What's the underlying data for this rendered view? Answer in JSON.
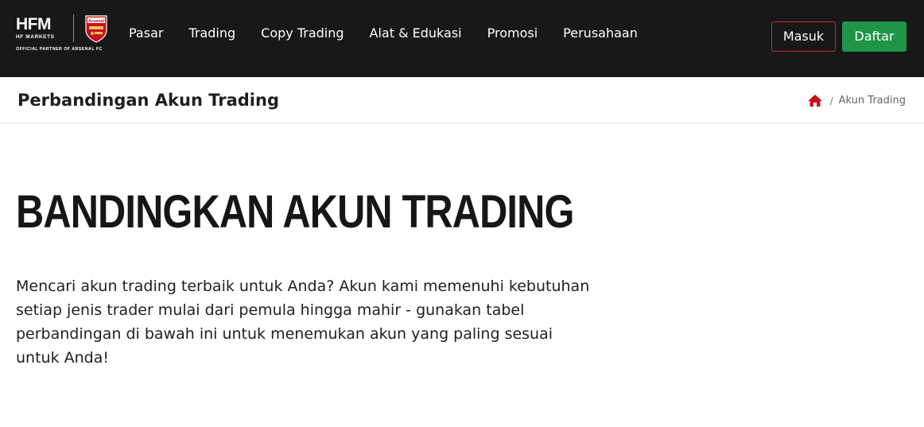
{
  "brand": {
    "logo_text": "HFM",
    "logo_subtext": "HF MARKETS",
    "partner_text": "OFFICIAL PARTNER OF ARSENAL FC",
    "crest_text": "Arsenal"
  },
  "nav": {
    "items": [
      "Pasar",
      "Trading",
      "Copy Trading",
      "Alat & Edukasi",
      "Promosi",
      "Perusahaan"
    ]
  },
  "auth": {
    "login_label": "Masuk",
    "register_label": "Daftar"
  },
  "page_header": {
    "title": "Perbandingan Akun Trading",
    "breadcrumb_separator": "/",
    "breadcrumb_current": "Akun Trading"
  },
  "hero": {
    "heading": "BANDINGKAN AKUN TRADING",
    "description": "Mencari akun trading terbaik untuk Anda? Akun kami memenuhi kebutuhan setiap jenis trader mulai dari pemula hingga mahir - gunakan tabel perbandingan di bawah ini untuk menemukan akun yang paling sesuai untuk Anda!"
  },
  "icons": {
    "home": "home-icon",
    "crest": "arsenal-crest-icon"
  },
  "colors": {
    "topbar_bg": "#181818",
    "login_border": "#d1262f",
    "register_bg": "#1e9547",
    "home_icon": "#c8101e"
  }
}
